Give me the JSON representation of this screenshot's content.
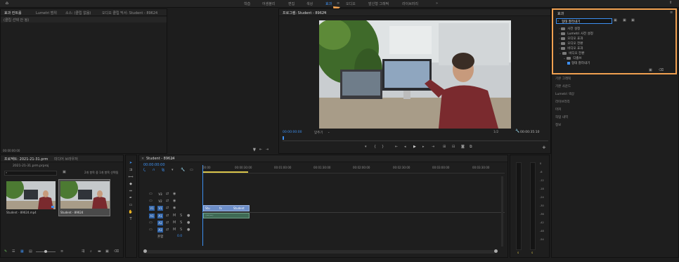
{
  "topbar": {
    "tabs": [
      "학습",
      "어셈블리",
      "편집",
      "색상",
      "효과",
      "오디오",
      "발신형 그래픽",
      "라이브러리"
    ],
    "active_tab": "효과",
    "more": "»"
  },
  "source_panel": {
    "tabs": [
      "효과 컨트롤",
      "Lumetri 범위",
      "소스: (클립 없음)",
      "오디오 클립 믹서: Student - 89624"
    ],
    "empty_text": "(클립 선택 안 됨)",
    "timecode": "00:00:00:00"
  },
  "program_panel": {
    "title": "프로그램: Student - 89624",
    "timecode": "00:00:00:00",
    "fit": "맞추기",
    "ratio": "1/2",
    "duration": "00:00:35:10"
  },
  "project_panel": {
    "tabs": [
      "프로젝트: 2021-21-31.prm",
      "미디어 브라우저"
    ],
    "file": "2021-21-31.prm.prproj",
    "count": "2개 항목 중 1개 항목 선택됨",
    "items": [
      {
        "name": "Student - 89624.mp4",
        "duration": ""
      },
      {
        "name": "Student - 89624",
        "duration": ""
      }
    ]
  },
  "timeline": {
    "title": "Student - 89624",
    "timecode": "00:00:00:00",
    "ruler": [
      "00:00",
      "00:00:30:00",
      "00:01:00:00",
      "00:01:30:00",
      "00:02:00:00",
      "00:02:30:00",
      "00:03:00:00",
      "00:03:30:00"
    ],
    "video_tracks": [
      "V3",
      "V2",
      "V1"
    ],
    "audio_tracks": [
      "A1",
      "A2",
      "A3"
    ],
    "master": "혼합",
    "master_value": "0.0",
    "clip_labels": [
      "Stu",
      "fx",
      "Student"
    ]
  },
  "effects_panel": {
    "title": "효과",
    "search_value": "형태 잘라내기",
    "tree": [
      "사전 설정",
      "Lumetri 사전 설정",
      "오디오 효과",
      "오디오 전환",
      "비디오 효과",
      "비디오 전환",
      "디졸브",
      "형태 잘라내기"
    ]
  },
  "right_panels": [
    "기본 그래픽",
    "기본 사운드",
    "Lumetri 색상",
    "라이브러리",
    "마커",
    "작업 내역",
    "정보"
  ],
  "audio_meter": {
    "scale": [
      "0",
      "-6",
      "-12",
      "-18",
      "-24",
      "-30",
      "-36",
      "-42",
      "-48",
      "-54"
    ],
    "channels": [
      "S",
      "S"
    ]
  },
  "colors": {
    "accent": "#3d8ff0",
    "highlight_box": "#f0a050",
    "track_on": "#2e62a8",
    "clip": "#6d8ec8"
  }
}
